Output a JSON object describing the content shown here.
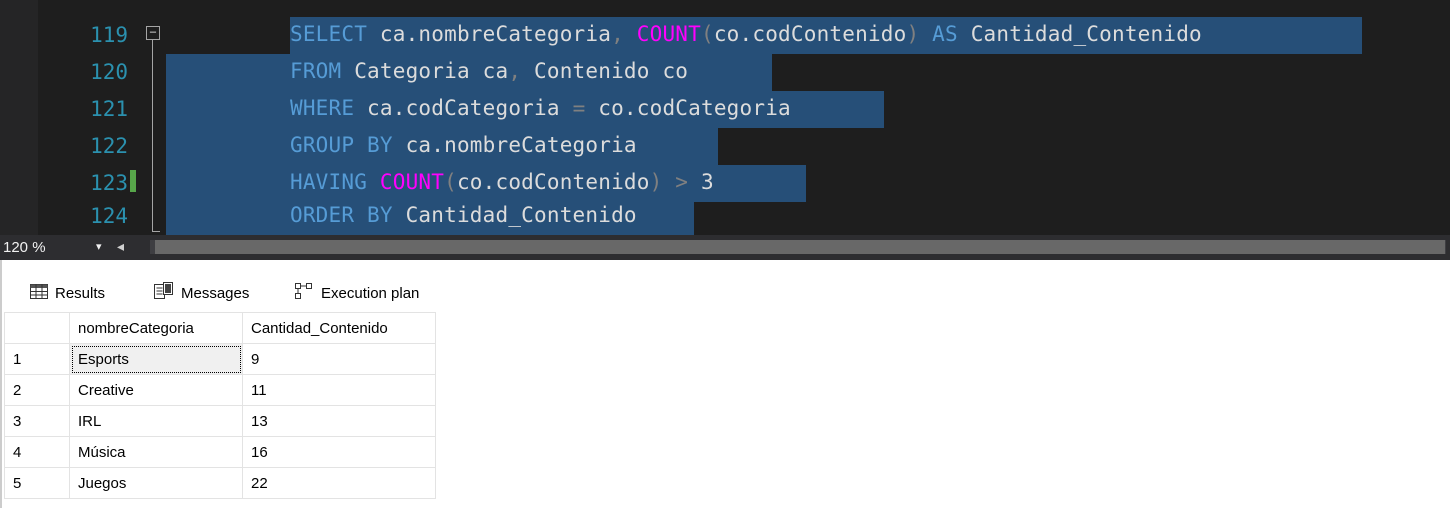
{
  "editor": {
    "lines": [
      {
        "number": "119",
        "tokens": [
          {
            "t": "SELECT",
            "c": "kw"
          },
          {
            "t": " ca.nombreCategoria",
            "c": "id"
          },
          {
            "t": ",",
            "c": "op"
          },
          {
            "t": " ",
            "c": "id"
          },
          {
            "t": "COUNT",
            "c": "fn"
          },
          {
            "t": "(",
            "c": "op"
          },
          {
            "t": "co.codContenido",
            "c": "id"
          },
          {
            "t": ")",
            "c": "op"
          },
          {
            "t": " AS",
            "c": "kw"
          },
          {
            "t": " Cantidad_Contenido",
            "c": "id"
          }
        ]
      },
      {
        "number": "120",
        "tokens": [
          {
            "t": "FROM",
            "c": "kw"
          },
          {
            "t": " Categoria ca",
            "c": "id"
          },
          {
            "t": ",",
            "c": "op"
          },
          {
            "t": " Contenido co",
            "c": "id"
          }
        ]
      },
      {
        "number": "121",
        "tokens": [
          {
            "t": "WHERE",
            "c": "kw"
          },
          {
            "t": " ca.codCategoria ",
            "c": "id"
          },
          {
            "t": "=",
            "c": "op"
          },
          {
            "t": " co.codCategoria",
            "c": "id"
          }
        ]
      },
      {
        "number": "122",
        "tokens": [
          {
            "t": "GROUP BY",
            "c": "kw"
          },
          {
            "t": " ca.nombreCategoria",
            "c": "id"
          }
        ]
      },
      {
        "number": "123",
        "tokens": [
          {
            "t": "HAVING",
            "c": "kw"
          },
          {
            "t": " ",
            "c": "id"
          },
          {
            "t": "COUNT",
            "c": "fn"
          },
          {
            "t": "(",
            "c": "op"
          },
          {
            "t": "co.codContenido",
            "c": "id"
          },
          {
            "t": ")",
            "c": "op"
          },
          {
            "t": " > ",
            "c": "op"
          },
          {
            "t": "3",
            "c": "id"
          }
        ]
      },
      {
        "number": "124",
        "tokens": [
          {
            "t": "ORDER BY",
            "c": "kw"
          },
          {
            "t": " Cantidad_Contenido",
            "c": "id"
          }
        ]
      }
    ]
  },
  "zoom": {
    "value": "120 %",
    "dropdown_glyph": "▾",
    "scroll_left_glyph": "◂"
  },
  "results": {
    "tabs": [
      {
        "label": "Results",
        "icon": "grid-icon"
      },
      {
        "label": "Messages",
        "icon": "messages-icon"
      },
      {
        "label": "Execution plan",
        "icon": "execution-plan-icon"
      }
    ],
    "columns": [
      "nombreCategoria",
      "Cantidad_Contenido"
    ],
    "rows": [
      {
        "num": "1",
        "nombreCategoria": "Esports",
        "cantidad": "9"
      },
      {
        "num": "2",
        "nombreCategoria": "Creative",
        "cantidad": "11"
      },
      {
        "num": "3",
        "nombreCategoria": "IRL",
        "cantidad": "13"
      },
      {
        "num": "4",
        "nombreCategoria": "Música",
        "cantidad": "16"
      },
      {
        "num": "5",
        "nombreCategoria": "Juegos",
        "cantidad": "22"
      }
    ]
  },
  "colors": {
    "editor_bg": "#1e1e1e",
    "selection": "#264f78",
    "keyword": "#569cd6",
    "function": "#ff00ff",
    "operator": "#808080",
    "line_number": "#2b91af"
  }
}
